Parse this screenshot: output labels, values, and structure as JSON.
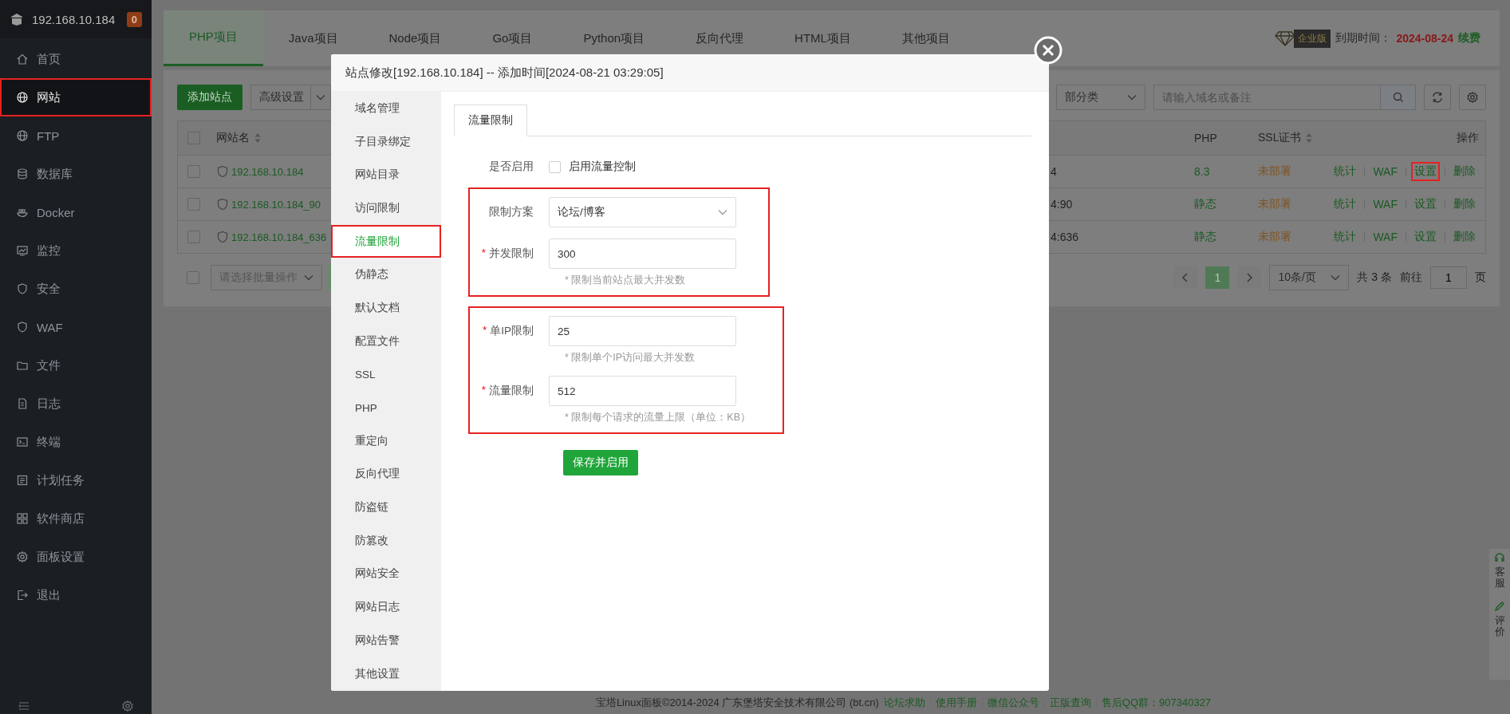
{
  "sidebar": {
    "host": "192.168.10.184",
    "badge": "0",
    "items": [
      {
        "label": "首页",
        "selected": false,
        "highlighted": false
      },
      {
        "label": "网站",
        "selected": true,
        "highlighted": true
      },
      {
        "label": "FTP",
        "selected": false,
        "highlighted": false
      },
      {
        "label": "数据库",
        "selected": false,
        "highlighted": false
      },
      {
        "label": "Docker",
        "selected": false,
        "highlighted": false
      },
      {
        "label": "监控",
        "selected": false,
        "highlighted": false
      },
      {
        "label": "安全",
        "selected": false,
        "highlighted": false
      },
      {
        "label": "WAF",
        "selected": false,
        "highlighted": false
      },
      {
        "label": "文件",
        "selected": false,
        "highlighted": false
      },
      {
        "label": "日志",
        "selected": false,
        "highlighted": false
      },
      {
        "label": "终端",
        "selected": false,
        "highlighted": false
      },
      {
        "label": "计划任务",
        "selected": false,
        "highlighted": false
      },
      {
        "label": "软件商店",
        "selected": false,
        "highlighted": false
      },
      {
        "label": "面板设置",
        "selected": false,
        "highlighted": false
      },
      {
        "label": "退出",
        "selected": false,
        "highlighted": false
      }
    ]
  },
  "project_tabs": [
    {
      "label": "PHP项目",
      "selected": true
    },
    {
      "label": "Java项目",
      "selected": false
    },
    {
      "label": "Node项目",
      "selected": false
    },
    {
      "label": "Go项目",
      "selected": false
    },
    {
      "label": "Python项目",
      "selected": false
    },
    {
      "label": "反向代理",
      "selected": false
    },
    {
      "label": "HTML项目",
      "selected": false
    },
    {
      "label": "其他项目",
      "selected": false
    }
  ],
  "license": {
    "edition": "企业版",
    "expiry_label": "到期时间：",
    "expiry_date": "2024-08-24",
    "renew": "续费"
  },
  "toolbar": {
    "add_button": "添加站点",
    "advanced": "高级设置",
    "category": "部分类",
    "search_placeholder": "请输入域名或备注"
  },
  "table": {
    "select_all_checked": false,
    "columns": [
      {
        "label": "网站名",
        "sortable": true
      },
      {
        "label": "PHP",
        "sortable": false
      },
      {
        "label": "SSL证书",
        "sortable": true
      },
      {
        "label": "操作",
        "sortable": false
      }
    ],
    "rows": [
      {
        "checked": false,
        "name": "192.168.10.184",
        "column_3": "4",
        "php": "8.3",
        "ssl": "未部署",
        "actions": [
          {
            "label": "统计",
            "highlighted": false
          },
          {
            "label": "WAF",
            "highlighted": false
          },
          {
            "label": "设置",
            "highlighted": true
          },
          {
            "label": "删除",
            "highlighted": false
          }
        ]
      },
      {
        "checked": false,
        "name": "192.168.10.184_90",
        "column_3": "4:90",
        "php": "静态",
        "ssl": "未部署",
        "actions": [
          {
            "label": "统计",
            "highlighted": false
          },
          {
            "label": "WAF",
            "highlighted": false
          },
          {
            "label": "设置",
            "highlighted": false
          },
          {
            "label": "删除",
            "highlighted": false
          }
        ]
      },
      {
        "checked": false,
        "name": "192.168.10.184_636",
        "column_3": "4:636",
        "php": "静态",
        "ssl": "未部署",
        "actions": [
          {
            "label": "统计",
            "highlighted": false
          },
          {
            "label": "WAF",
            "highlighted": false
          },
          {
            "label": "设置",
            "highlighted": false
          },
          {
            "label": "删除",
            "highlighted": false
          }
        ]
      }
    ]
  },
  "pagination": {
    "select_all_checked": false,
    "batch_placeholder": "请选择批量操作",
    "page": "1",
    "page_size": "10条/页",
    "total": "共 3 条",
    "goto_label": "前往",
    "goto_value": "1",
    "page_unit": "页"
  },
  "footer": {
    "copyright": "宝塔Linux面板©2014-2024 广东堡塔安全技术有限公司 (bt.cn)",
    "links": [
      "论坛求助",
      "使用手册",
      "微信公众号",
      "正版查询",
      "售后QQ群：907340327"
    ]
  },
  "side_widget": [
    "客服",
    "评价"
  ],
  "modal": {
    "title": "站点修改[192.168.10.184] -- 添加时间[2024-08-21 03:29:05]",
    "nav": [
      {
        "label": "域名管理",
        "selected": false,
        "highlighted": false
      },
      {
        "label": "子目录绑定",
        "selected": false,
        "highlighted": false
      },
      {
        "label": "网站目录",
        "selected": false,
        "highlighted": false
      },
      {
        "label": "访问限制",
        "selected": false,
        "highlighted": false
      },
      {
        "label": "流量限制",
        "selected": true,
        "highlighted": true
      },
      {
        "label": "伪静态",
        "selected": false,
        "highlighted": false
      },
      {
        "label": "默认文档",
        "selected": false,
        "highlighted": false
      },
      {
        "label": "配置文件",
        "selected": false,
        "highlighted": false
      },
      {
        "label": "SSL",
        "selected": false,
        "highlighted": false
      },
      {
        "label": "PHP",
        "selected": false,
        "highlighted": false
      },
      {
        "label": "重定向",
        "selected": false,
        "highlighted": false
      },
      {
        "label": "反向代理",
        "selected": false,
        "highlighted": false
      },
      {
        "label": "防盗链",
        "selected": false,
        "highlighted": false
      },
      {
        "label": "防篡改",
        "selected": false,
        "highlighted": false
      },
      {
        "label": "网站安全",
        "selected": false,
        "highlighted": false
      },
      {
        "label": "网站日志",
        "selected": false,
        "highlighted": false
      },
      {
        "label": "网站告警",
        "selected": false,
        "highlighted": false
      },
      {
        "label": "其他设置",
        "selected": false,
        "highlighted": false
      }
    ],
    "tab": "流量限制",
    "enable": {
      "label": "是否启用",
      "checkbox_label": "启用流量控制",
      "checked": false
    },
    "groups": [
      {
        "highlighted": true,
        "fields": [
          {
            "kind": "select",
            "label": "限制方案",
            "value": "论坛/博客"
          },
          {
            "kind": "input",
            "mark": "*",
            "label": "并发限制",
            "value": "300",
            "hint": "* 限制当前站点最大并发数"
          }
        ]
      },
      {
        "highlighted": true,
        "fields": [
          {
            "kind": "input",
            "mark": "*",
            "label": "单IP限制",
            "value": "25",
            "hint": "* 限制单个IP访问最大并发数"
          },
          {
            "kind": "input",
            "mark": "*",
            "label": "流量限制",
            "value": "512",
            "hint": "* 限制每个请求的流量上限（单位：KB）"
          }
        ]
      }
    ],
    "submit": "保存并启用"
  }
}
